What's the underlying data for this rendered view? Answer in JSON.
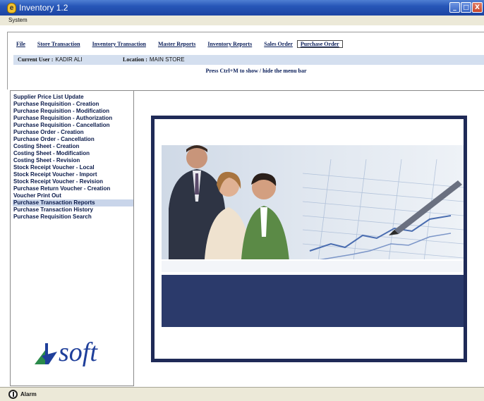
{
  "window": {
    "title": "Inventory 1.2",
    "buttons": [
      "_",
      "□",
      "X"
    ]
  },
  "system_menu": {
    "label": "System"
  },
  "menubar": {
    "items": [
      {
        "label": "File"
      },
      {
        "label": "Store Transaction"
      },
      {
        "label": "Inventory Transaction"
      },
      {
        "label": "Master Reports"
      },
      {
        "label": "Inventory Reports"
      },
      {
        "label": "Sales Order"
      },
      {
        "label": "Purchase Order",
        "active": true
      }
    ]
  },
  "info": {
    "user_label": "Current User :",
    "user_value": "KADIR ALI",
    "location_label": "Location :",
    "location_value": "MAIN STORE"
  },
  "hint": "Press Ctrl+M to show / hide the menu bar",
  "side_menu": {
    "items": [
      "Supplier Price List Update",
      "Purchase Requisition - Creation",
      "Purchase Requisition - Modification",
      "Purchase Requisition - Authorization",
      "Purchase Requisition - Cancellation",
      "Purchase Order - Creation",
      "Purchase Order - Cancellation",
      "Costing Sheet - Creation",
      "Costing Sheet - Modification",
      "Costing Sheet - Revision",
      "Stock Receipt Voucher - Local",
      "Stock Receipt Voucher - Import",
      "Stock Receipt Voucher - Revision",
      "Purchase Return Voucher - Creation",
      "Voucher Print Out",
      "Purchase Transaction Reports",
      "Purchase Transaction History",
      "Purchase Requisition Search"
    ],
    "selected_index": 15
  },
  "logo": {
    "text": "soft"
  },
  "status": {
    "text": "Alarm"
  },
  "colors": {
    "titlebar": "#2756b7",
    "frame": "#1f2a57",
    "banner": "#2b3a6b"
  }
}
